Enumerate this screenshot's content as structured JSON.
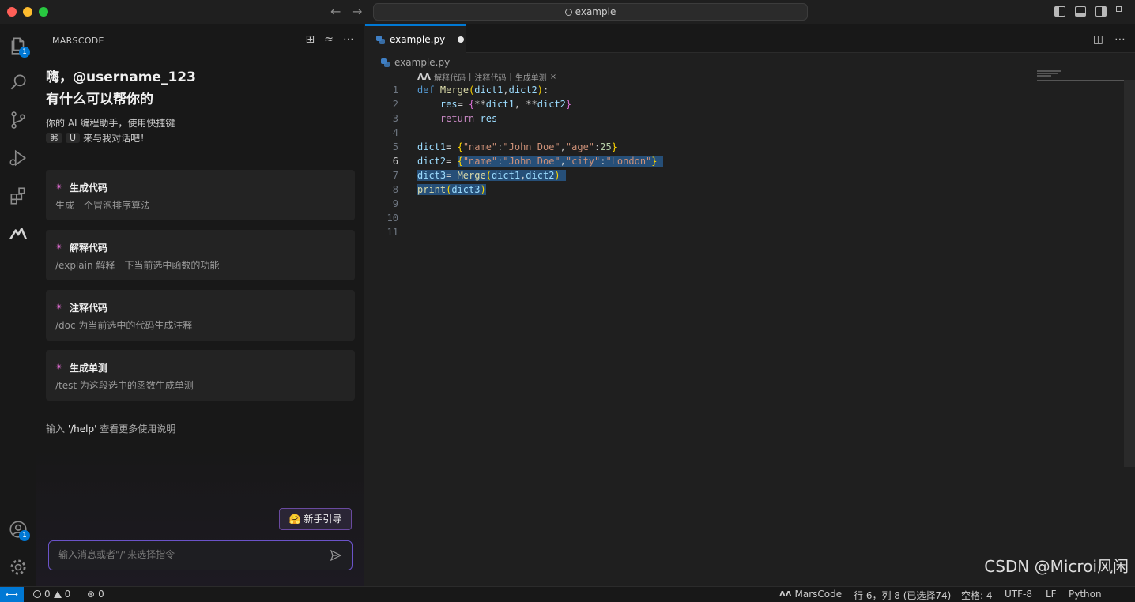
{
  "titlebar": {
    "search_text": "example"
  },
  "activity": {
    "explorer_badge": "1",
    "account_badge": "1"
  },
  "panel": {
    "title": "MARSCODE",
    "greeting_line1": "嗨，@username_123",
    "greeting_line2": "有什么可以帮你的",
    "desc_line1": "你的 AI 编程助手，使用快捷键",
    "shortcut_cmd": "⌘",
    "shortcut_key": "U",
    "desc_line2_tail": "来与我对话吧！",
    "cards": [
      {
        "title": "生成代码",
        "desc": "生成一个冒泡排序算法"
      },
      {
        "title": "解释代码",
        "desc": "/explain 解释一下当前选中函数的功能"
      },
      {
        "title": "注释代码",
        "desc": "/doc 为当前选中的代码生成注释"
      },
      {
        "title": "生成单测",
        "desc": "/test 为这段选中的函数生成单测"
      }
    ],
    "help_prefix": "输入",
    "help_cmd": "'/help'",
    "help_suffix": "查看更多使用说明",
    "guide_button": "🤗 新手引导",
    "input_placeholder": "输入消息或者\"/\"来选择指令"
  },
  "editor": {
    "tab_label": "example.py",
    "breadcrumb_file": "example.py",
    "codelens": [
      "解释代码",
      "注释代码",
      "生成单测"
    ],
    "codelens_sep": "|",
    "line_numbers": [
      "1",
      "2",
      "3",
      "4",
      "5",
      "6",
      "7",
      "8",
      "9",
      "10",
      "11"
    ],
    "active_line": "6"
  },
  "statusbar": {
    "errors": "0",
    "warnings": "0",
    "ports": "0",
    "marscode": "MarsCode",
    "cursor": "行 6，列 8 (已选择74)",
    "spaces": "空格: 4",
    "encoding": "UTF-8",
    "eol": "LF",
    "language": "Python"
  },
  "watermark": "CSDN @Microi风闲",
  "colors": {
    "accent": "#0078d4",
    "selection": "#264f78",
    "input_border": "#6b53c9"
  }
}
